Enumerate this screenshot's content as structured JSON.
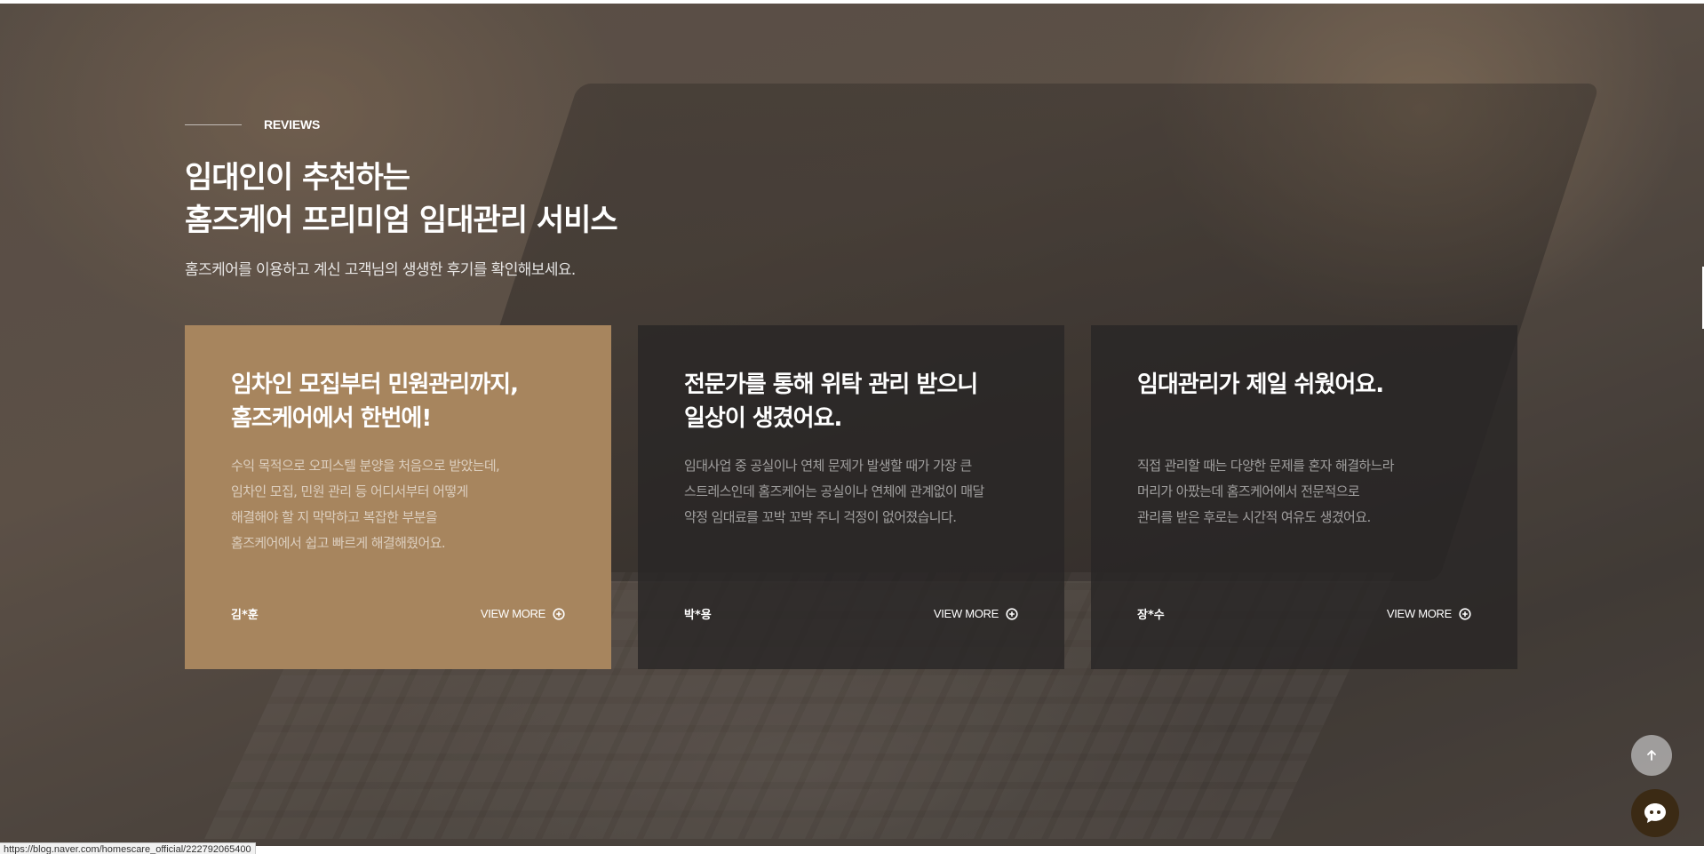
{
  "section": {
    "eyebrow": "REVIEWS",
    "title_line1": "임대인이 추천하는",
    "title_line2": "홈즈케어 프리미엄 임대관리 서비스",
    "subtitle": "홈즈케어를 이용하고 계신 고객님의 생생한 후기를 확인해보세요."
  },
  "cards": [
    {
      "title_line1": "임차인 모집부터 민원관리까지,",
      "title_line2": "홈즈케어에서 한번에!",
      "body": [
        "수익 목적으로 오피스텔 분양을 처음으로 받았는데,",
        "임차인 모집, 민원 관리 등 어디서부터 어떻게",
        "해결해야 할 지 막막하고 복잡한 부분을",
        "홈즈케어에서 쉽고 빠르게 해결해줬어요."
      ],
      "author": "김*훈",
      "more": "VIEW MORE"
    },
    {
      "title_line1": "전문가를 통해 위탁 관리 받으니",
      "title_line2": "일상이 생겼어요.",
      "body": [
        "임대사업 중 공실이나 연체 문제가 발생할 때가 가장 큰",
        "스트레스인데 홈즈케어는 공실이나 연체에 관계없이 매달",
        "약정 임대료를 꼬박 꼬박 주니 걱정이 없어졌습니다."
      ],
      "author": "박*용",
      "more": "VIEW MORE"
    },
    {
      "title_line1": "임대관리가 제일 쉬웠어요.",
      "title_line2": "",
      "body": [
        "직접 관리할 때는 다양한 문제를 혼자 해결하느라",
        "머리가 아팠는데 홈즈케어에서 전문적으로",
        "관리를 받은 후로는 시간적 여유도 생겼어요."
      ],
      "author": "장*수",
      "more": "VIEW MORE"
    }
  ],
  "floating": {
    "top_icon": "arrow-up-icon",
    "chat_icon": "chat-bubble-icon"
  },
  "status_bar": {
    "url": "https://blog.naver.com/homescare_official/222792065400"
  },
  "colors": {
    "active_card": "#a7855e",
    "dark_card": "#282625",
    "chat_button": "#3b2a14"
  }
}
